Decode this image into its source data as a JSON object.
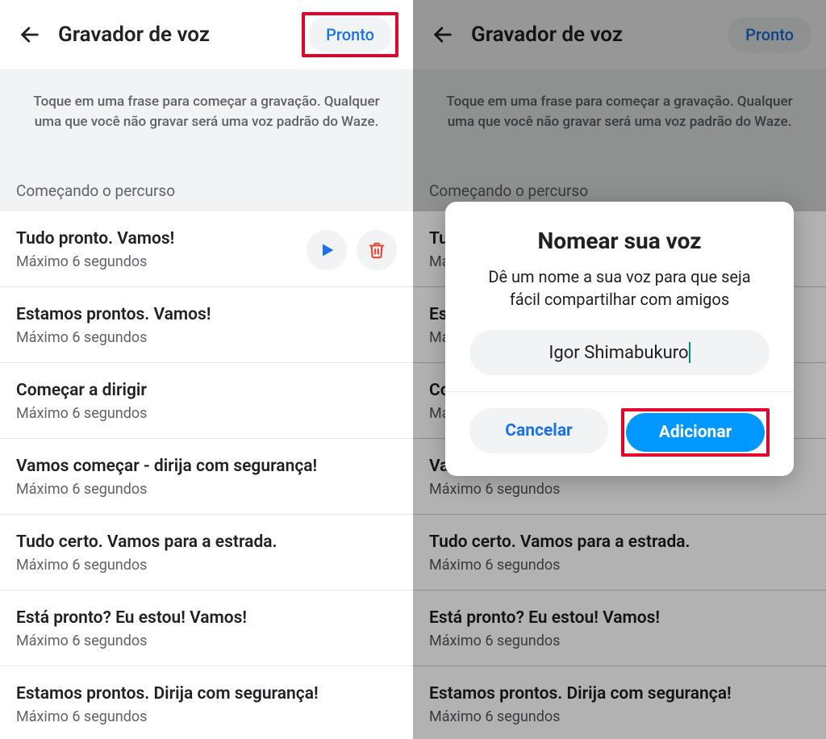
{
  "header": {
    "title": "Gravador de voz",
    "done_label": "Pronto"
  },
  "instruction": "Toque em uma frase para começar a gravação. Qualquer uma que você não gravar será uma voz padrão do Waze.",
  "section_label": "Começando o percurso",
  "max_label": "Máximo 6 segundos",
  "phrases": [
    {
      "title": "Tudo pronto. Vamos!",
      "has_actions": true
    },
    {
      "title": "Estamos prontos. Vamos!",
      "has_actions": false
    },
    {
      "title": "Começar a dirigir",
      "has_actions": false
    },
    {
      "title": "Vamos começar - dirija com segurança!",
      "has_actions": false
    },
    {
      "title": "Tudo certo. Vamos para a estrada.",
      "has_actions": false
    },
    {
      "title": "Está pronto? Eu estou! Vamos!",
      "has_actions": false
    },
    {
      "title": "Estamos prontos. Dirija com segurança!",
      "has_actions": false
    }
  ],
  "modal": {
    "title": "Nomear sua voz",
    "subtitle": "Dê um nome a sua voz para que seja fácil compartilhar com amigos",
    "input_value": "Igor Shimabukuro",
    "cancel_label": "Cancelar",
    "add_label": "Adicionar"
  },
  "icons": {
    "back": "arrow-left",
    "play": "play",
    "trash": "trash"
  }
}
